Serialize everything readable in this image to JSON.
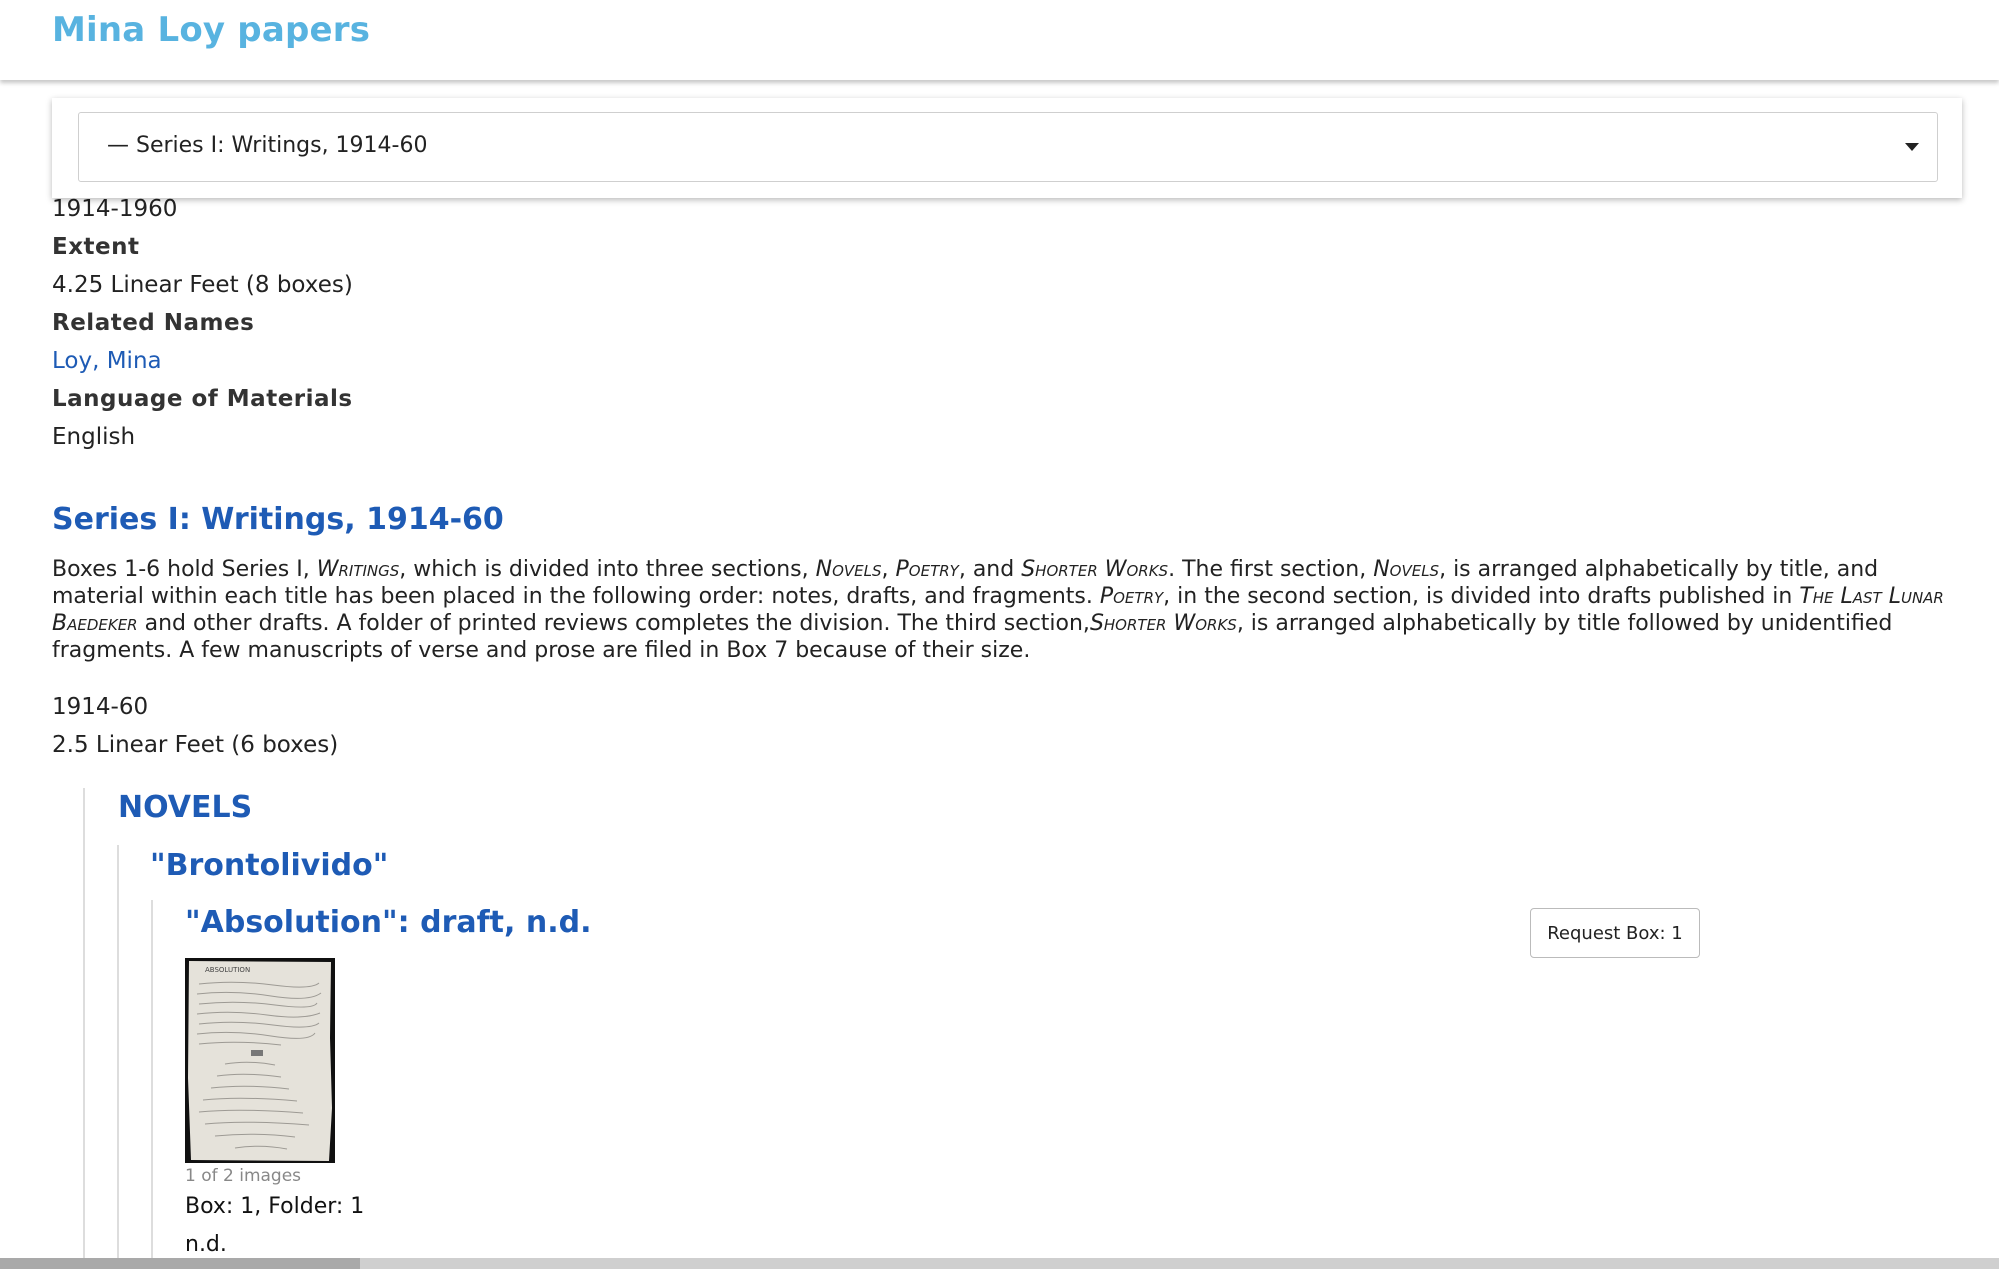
{
  "header": {
    "title": "Mina Loy papers"
  },
  "series_select": {
    "selected": "— Series I: Writings, 1914-60"
  },
  "collection": {
    "dates": "1914-1960",
    "extent_label": "Extent",
    "extent_value": "4.25 Linear Feet (8 boxes)",
    "related_names_label": "Related Names",
    "related_names": [
      "Loy, Mina"
    ],
    "language_label": "Language of Materials",
    "language_value": "English"
  },
  "series": {
    "title": "Series I: Writings, 1914-60",
    "description": {
      "t1": "Boxes 1-6 hold Series I, ",
      "sc1": "Writings",
      "t2": ", which is divided into three sections, ",
      "sc2": "Novels",
      "t3": ", ",
      "sc3": "Poetry",
      "t4": ", and ",
      "sc4": "Shorter Works",
      "t5": ". The first section, ",
      "sc5": "Novels",
      "t6": ", is arranged alphabetically by title, and material within each title has been placed in the following order: notes, drafts, and fragments. ",
      "sc6": "Poetry",
      "t7": ", in the second section, is divided into drafts published in ",
      "sc7": "The Last Lunar Baedeker",
      "t8": " and other drafts. A folder of printed reviews completes the division. The third section,",
      "sc8": "Shorter Works",
      "t9": ", is arranged alphabetically by title followed by unidentified fragments. A few manuscripts of verse and prose are filed in Box 7 because of their size."
    },
    "dates": "1914-60",
    "extent": "2.5 Linear Feet (6 boxes)"
  },
  "subseries": {
    "title": "NOVELS"
  },
  "file": {
    "title": "\"Brontolivido\""
  },
  "item": {
    "title": "\"Absolution\": draft, n.d.",
    "request_label": "Request Box: 1",
    "thumbnail_heading": "ABSOLUTION",
    "image_count": "1 of 2 images",
    "box_folder": "Box: 1, Folder: 1",
    "date": "n.d."
  },
  "colors": {
    "brand": "#58b3e0",
    "link": "#1e5bb5",
    "text": "#222222"
  }
}
